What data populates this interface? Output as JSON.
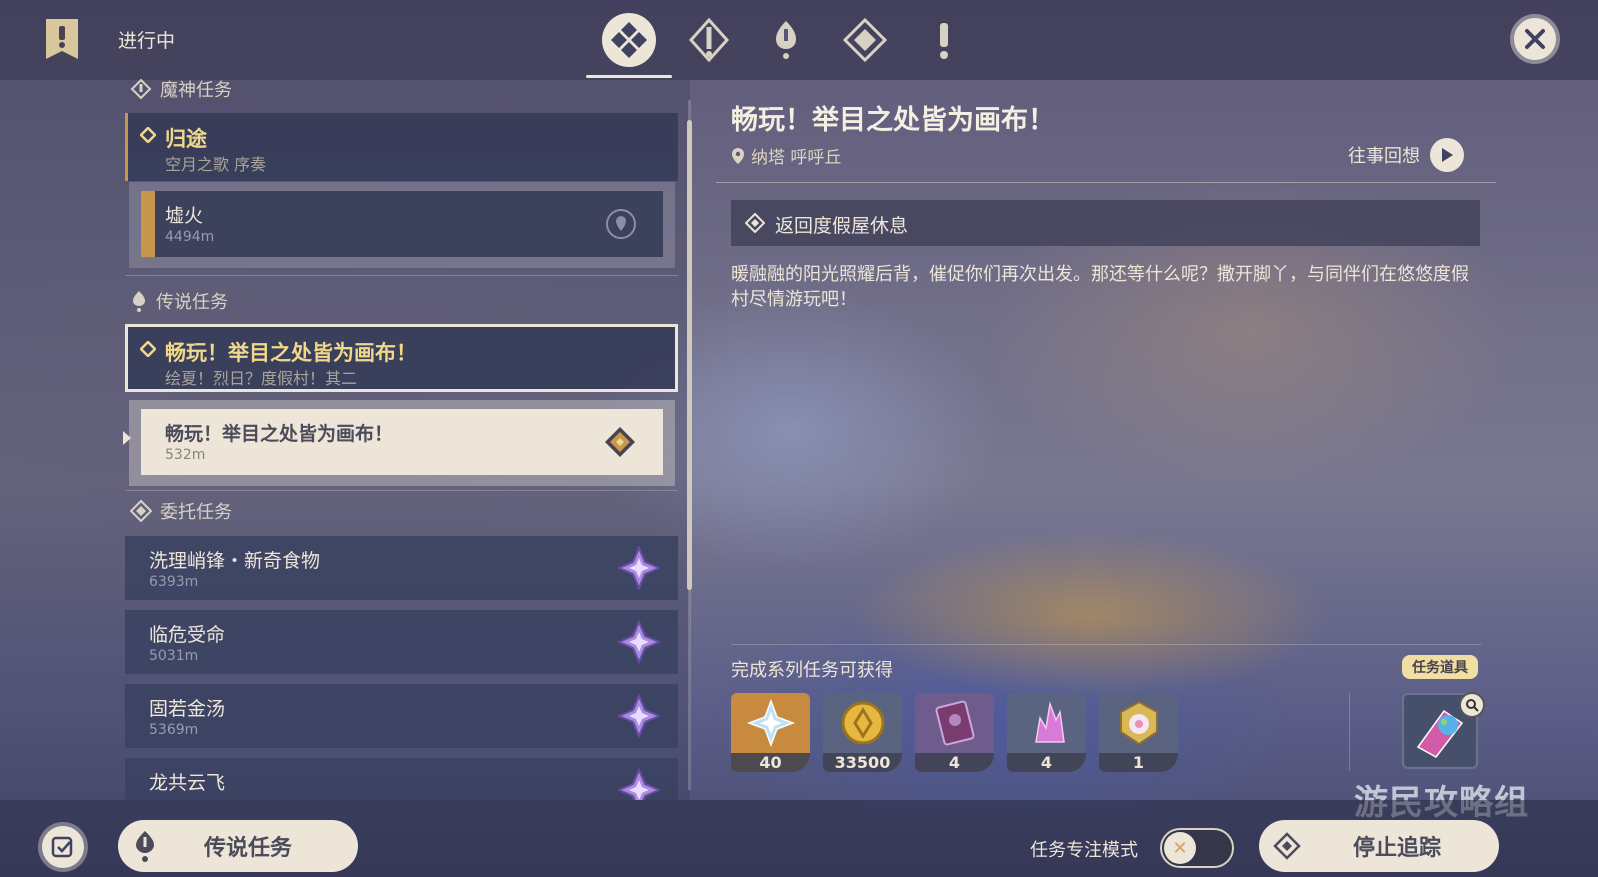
{
  "header": {
    "status_title": "进行中",
    "tabs": [
      {
        "icon": "all-quests-icon",
        "active": true
      },
      {
        "icon": "archon-quest-icon",
        "active": false
      },
      {
        "icon": "story-quest-icon",
        "active": false
      },
      {
        "icon": "commission-icon",
        "active": false
      },
      {
        "icon": "world-quest-icon",
        "active": false
      }
    ],
    "close_icon": "close-icon"
  },
  "quest_list": {
    "archon_section": {
      "label": "魔神任务"
    },
    "archon_quest": {
      "title": "归途",
      "subtitle": "空月之歌 序奏"
    },
    "archon_step": {
      "title": "墟火",
      "distance": "4494m"
    },
    "legend_section": {
      "label": "传说任务"
    },
    "legend_quest": {
      "title": "畅玩！举目之处皆为画布！",
      "subtitle": "绘夏！烈日？度假村！其二"
    },
    "legend_step": {
      "title": "畅玩！举目之处皆为画布！",
      "distance": "532m"
    },
    "commission_section": {
      "label": "委托任务"
    },
    "commissions": [
      {
        "title": "洗理峭锋・新奇食物",
        "distance": "6393m"
      },
      {
        "title": "临危受命",
        "distance": "5031m"
      },
      {
        "title": "固若金汤",
        "distance": "5369m"
      },
      {
        "title": "龙共云飞",
        "distance": ""
      }
    ]
  },
  "detail": {
    "title": "畅玩！举目之处皆为画布！",
    "location": "纳塔 呼呼丘",
    "recall_label": "往事回想",
    "objective": "返回度假屋休息",
    "description": "暖融融的阳光照耀后背，催促你们再次出发。那还等什么呢？撒开脚丫，与同伴们在悠悠度假村尽情游玩吧！",
    "rewards_label": "完成系列任务可获得",
    "rewards": [
      {
        "icon": "primogem-icon",
        "count": "40",
        "color": "#c78a3e"
      },
      {
        "icon": "mora-icon",
        "count": "33500",
        "color": "#5a6480"
      },
      {
        "icon": "talent-book-icon",
        "count": "4",
        "color": "#6e5c8c"
      },
      {
        "icon": "crystal-icon",
        "count": "4",
        "color": "#5a6480"
      },
      {
        "icon": "companionship-exp-icon",
        "count": "1",
        "color": "#5a6480"
      }
    ],
    "quest_item_badge": "任务道具"
  },
  "watermark": "游民攻略组",
  "footer": {
    "legend_button": "传说任务",
    "focus_mode_label": "任务专注模式",
    "focus_mode_on": false,
    "stop_tracking": "停止追踪"
  }
}
